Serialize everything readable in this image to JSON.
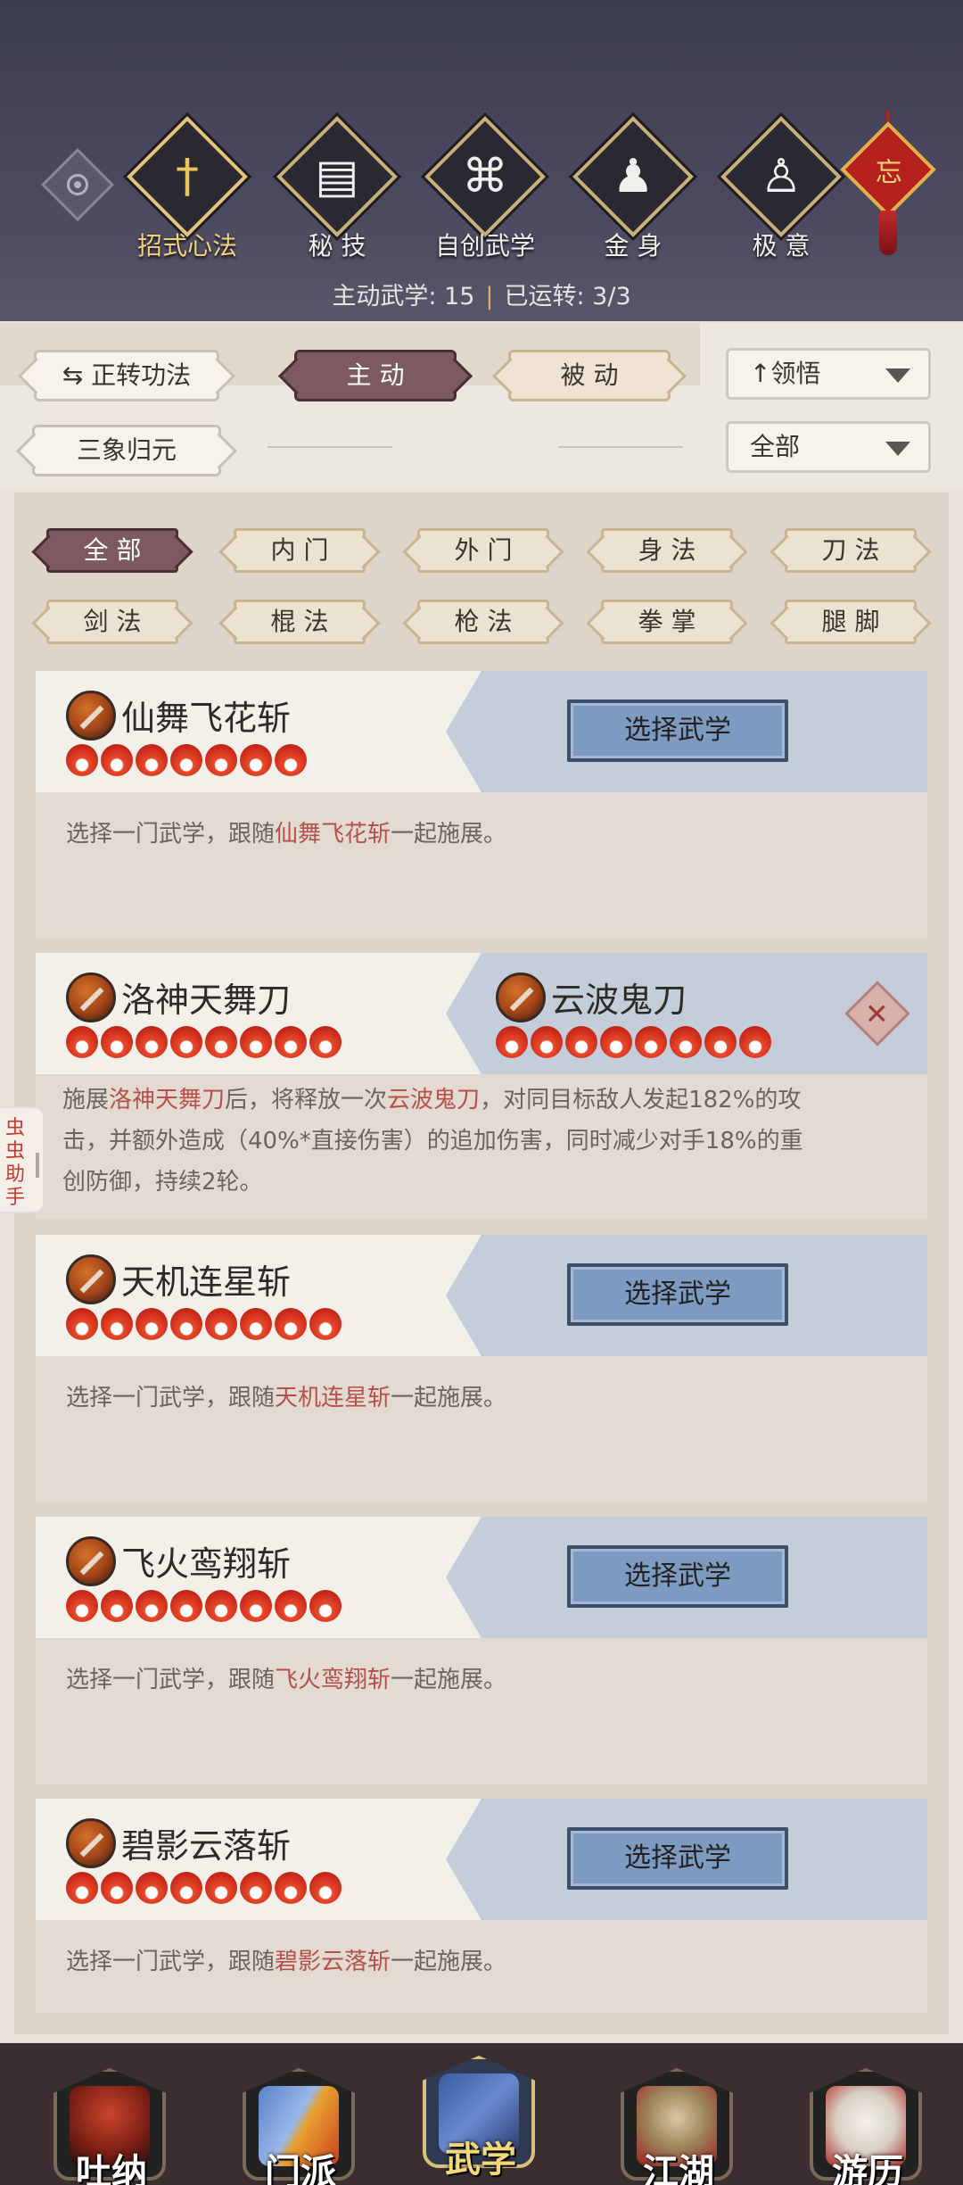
{
  "header": {
    "categories": [
      {
        "label": "招式心法",
        "icon": "sword-icon",
        "active": true
      },
      {
        "label": "秘 技",
        "icon": "book-icon",
        "active": false
      },
      {
        "label": "自创武学",
        "icon": "scroll-icon",
        "active": false
      },
      {
        "label": "金 身",
        "icon": "meditation-icon",
        "active": false
      },
      {
        "label": "极 意",
        "icon": "martial-pose-icon",
        "active": false
      }
    ],
    "knot_char": "忘",
    "stats": {
      "active_label": "主动武学: 15",
      "running_label": "已运转: 3/3"
    }
  },
  "controls": {
    "toggle_label": "正转功法",
    "mode_tabs": [
      {
        "label": "主 动",
        "active": true
      },
      {
        "label": "被 动",
        "active": false
      }
    ],
    "sort_label": "领悟",
    "secondary_button": "三象归元",
    "scope_dropdown": "全部"
  },
  "filters": {
    "row1": [
      {
        "label": "全 部",
        "active": true
      },
      {
        "label": "内 门",
        "active": false
      },
      {
        "label": "外 门",
        "active": false
      },
      {
        "label": "身 法",
        "active": false
      },
      {
        "label": "刀 法",
        "active": false
      }
    ],
    "row2": [
      {
        "label": "剑 法",
        "active": false
      },
      {
        "label": "棍 法",
        "active": false
      },
      {
        "label": "枪 法",
        "active": false
      },
      {
        "label": "拳 掌",
        "active": false
      },
      {
        "label": "腿 脚",
        "active": false
      }
    ]
  },
  "cards": [
    {
      "name": "仙舞飞花斩",
      "stars": 7,
      "button": "选择武学",
      "desc_prefix": "选择一门武学，跟随",
      "desc_highlight": "仙舞飞花斩",
      "desc_suffix": "一起施展。"
    },
    {
      "name": "洛神天舞刀",
      "stars": 8,
      "partner_name": "云波鬼刀",
      "partner_stars": 8,
      "remove_icon": "✕",
      "desc_line1_a": "施展",
      "desc_line1_hl1": "洛神天舞刀",
      "desc_line1_b": "后，将释放一次",
      "desc_line1_hl2": "云波鬼刀",
      "desc_line1_c": "，对同目标敌人发起182%的攻",
      "desc_line2": "击，并额外造成（40%*直接伤害）的追加伤害，同时减少对手18%的重",
      "desc_line3": "创防御，持续2轮。"
    },
    {
      "name": "天机连星斩",
      "stars": 8,
      "button": "选择武学",
      "desc_prefix": "选择一门武学，跟随",
      "desc_highlight": "天机连星斩",
      "desc_suffix": "一起施展。"
    },
    {
      "name": "飞火鸾翔斩",
      "stars": 8,
      "button": "选择武学",
      "desc_prefix": "选择一门武学，跟随",
      "desc_highlight": "飞火鸾翔斩",
      "desc_suffix": "一起施展。"
    },
    {
      "name": "碧影云落斩",
      "stars": 8,
      "button": "选择武学",
      "desc_prefix": "选择一门武学，跟随",
      "desc_highlight": "碧影云落斩",
      "desc_suffix": "一起施展。"
    }
  ],
  "side_tab": "虫虫助手",
  "bottom_nav": [
    {
      "label": "吐纳",
      "icon": "monk-icon",
      "active": false
    },
    {
      "label": "门派",
      "icon": "sect-banner-icon",
      "active": false
    },
    {
      "label": "武学",
      "icon": "martial-manual-icon",
      "active": true
    },
    {
      "label": "江湖",
      "icon": "straw-hat-icon",
      "active": false
    },
    {
      "label": "游历",
      "icon": "horse-icon",
      "active": false
    }
  ],
  "colors": {
    "accent_dark": "#7d5a60",
    "select_button": "#7d9ac0",
    "highlight_text": "#b5504a",
    "star_red": "#c8281a"
  }
}
